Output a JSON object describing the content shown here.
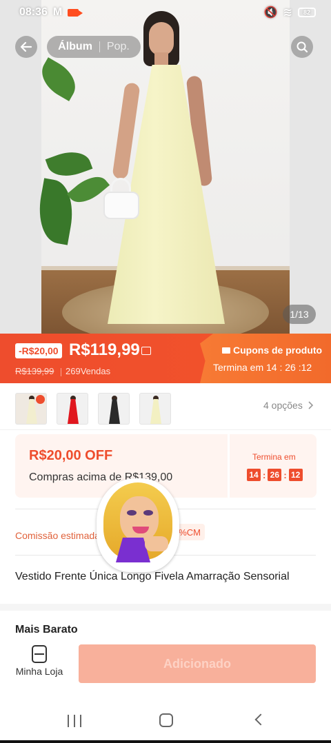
{
  "status_bar": {
    "time": "08:36",
    "battery": "82"
  },
  "nav": {
    "album_tab": "Álbum",
    "pop_tab": "Pop.",
    "image_counter": "1/13"
  },
  "price": {
    "discount_badge": "-R$20,00",
    "current": "R$119,99",
    "original": "R$139,99",
    "sold": "269Vendas",
    "coupon_title": "Cupons de produto",
    "coupon_ends": "Termina em 14 : 26 :12"
  },
  "variations": {
    "options_label": "4 opções"
  },
  "voucher": {
    "off_label": "R$20,00 OFF",
    "min_purchase": "Compras acima de R$139,00",
    "ends_label": "Termina em",
    "timer": [
      "14",
      "26",
      "12"
    ]
  },
  "commission": {
    "label": "Comissão estimada",
    "badge": "6%CM"
  },
  "product": {
    "title": "Vestido Frente Única Longo Fivela Amarração Sensorial"
  },
  "section": {
    "cheapest": "Mais Barato"
  },
  "actions": {
    "shop_label": "Minha Loja",
    "add_label": "Adicionado"
  },
  "colors": {
    "accent": "#ee4d2d",
    "coupon_orange": "#f77a34",
    "button_disabled": "#f8b09b"
  }
}
